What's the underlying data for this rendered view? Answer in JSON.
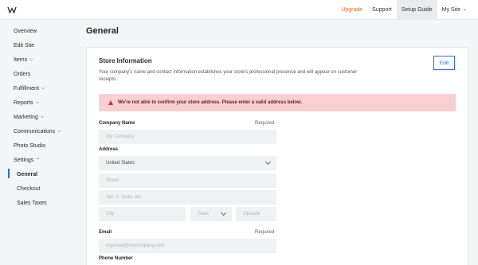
{
  "topnav": {
    "upgrade": "Upgrade",
    "support": "Support",
    "setup_guide": "Setup Guide",
    "my_site": "My Site"
  },
  "sidebar": {
    "items": [
      {
        "label": "Overview"
      },
      {
        "label": "Edit Site"
      },
      {
        "label": "Items"
      },
      {
        "label": "Orders"
      },
      {
        "label": "Fulfillment"
      },
      {
        "label": "Reports"
      },
      {
        "label": "Marketing"
      },
      {
        "label": "Communications"
      },
      {
        "label": "Photo Studio"
      },
      {
        "label": "Settings"
      }
    ],
    "sub_items": [
      {
        "label": "General"
      },
      {
        "label": "Checkout"
      },
      {
        "label": "Sales Taxes"
      }
    ]
  },
  "main": {
    "page_title": "General",
    "card": {
      "title": "Store Information",
      "description": "Your company's name and contact information establishes your store's professional presence and will appear on customer receipts.",
      "edit_label": "Edit",
      "alert": "We're not able to confirm your store address. Please enter a valid address below.",
      "company_name": {
        "label": "Company Name",
        "required": "Required",
        "placeholder": "My Company"
      },
      "address": {
        "label": "Address",
        "country": "United States",
        "street_placeholder": "Street",
        "apt_placeholder": "Apt. #, Suite, etc.",
        "city_placeholder": "City",
        "state_placeholder": "State",
        "zip_placeholder": "Zipcode"
      },
      "email": {
        "label": "Email",
        "required": "Required",
        "placeholder": "myemail@mycompany.com"
      },
      "phone": {
        "label": "Phone Number"
      }
    }
  },
  "colors": {
    "accent": "#2e6ad6",
    "upgrade": "#e07020",
    "alert_bg": "#f9cfd2",
    "alert_icon": "#c9302c"
  }
}
